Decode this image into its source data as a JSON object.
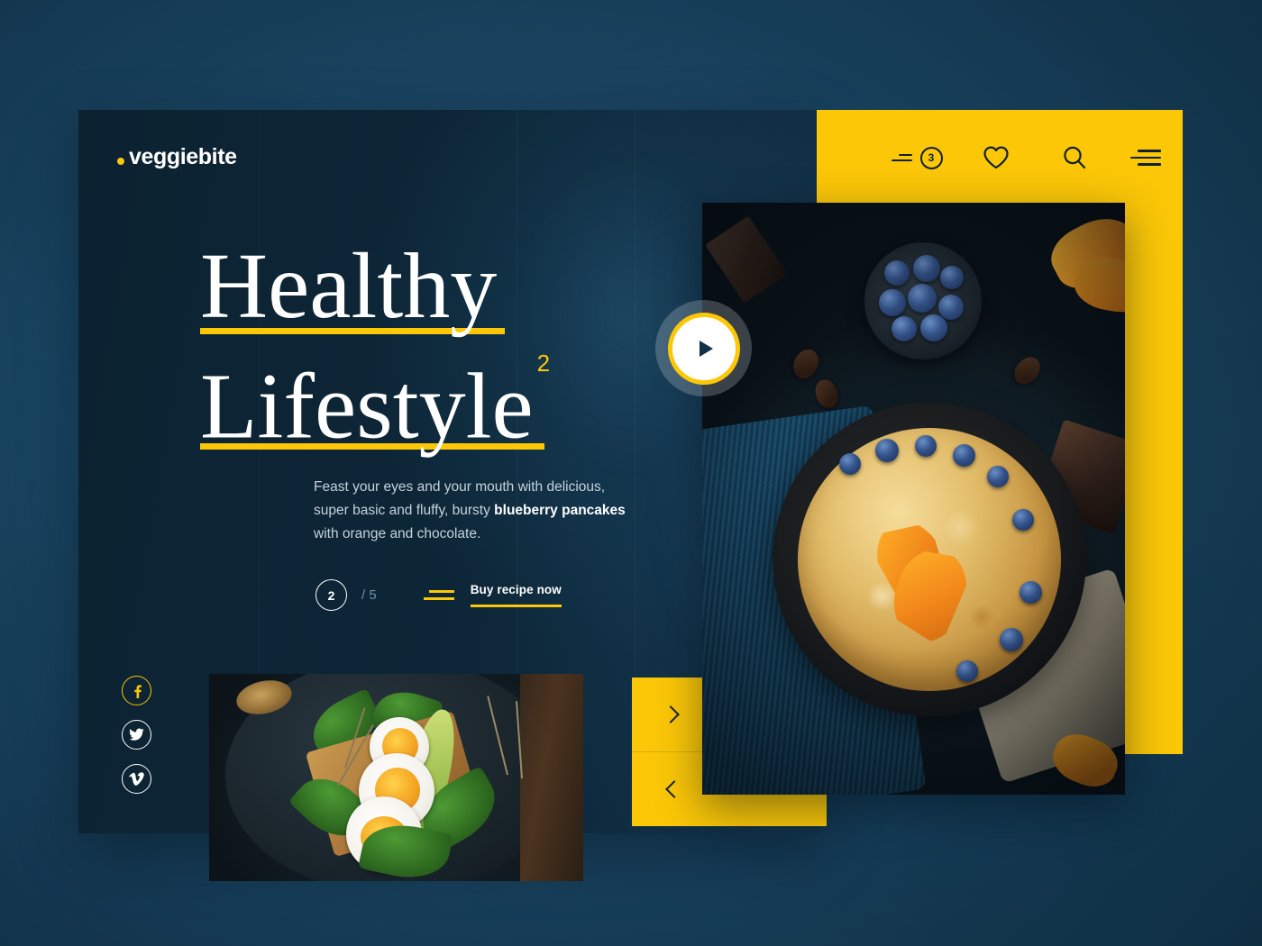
{
  "brand": {
    "dot": "•",
    "name": "veggiebite"
  },
  "colors": {
    "accent_yellow": "#fbc707",
    "card_navy": "#0d2434",
    "page_blue": "#1d4a69",
    "text_white": "#ffffff",
    "text_muted": "#c6d2da"
  },
  "header": {
    "cart": {
      "icon": "cart-lines-icon",
      "badge_count": "3"
    },
    "favorites": {
      "icon": "heart-icon",
      "label": "Favorites"
    },
    "search": {
      "icon": "search-icon",
      "label": "Search"
    },
    "menu": {
      "icon": "hamburger-menu-icon",
      "label": "Menu"
    }
  },
  "hero": {
    "headline_line1": "Healthy",
    "headline_line2": "Lifestyle",
    "headline_superscript": "2",
    "lede_part1": "Feast your eyes and your mouth with delicious, super basic and fluffy, bursty ",
    "lede_highlight": "blueberry pancakes",
    "lede_part2": " with orange and chocolate."
  },
  "pager": {
    "current": "2",
    "total": "/ 5"
  },
  "cta": {
    "icon": "lines-icon",
    "label": "Buy recipe now"
  },
  "social": [
    {
      "name": "facebook",
      "glyph": "f",
      "active": true
    },
    {
      "name": "twitter",
      "glyph": "t",
      "active": false
    },
    {
      "name": "vimeo",
      "glyph": "v",
      "active": false
    }
  ],
  "media": {
    "play_button": {
      "icon": "play-icon",
      "label": "Play video"
    },
    "main_photo_alt": "Blueberry pancakes in a cast iron skillet with orange slices and chocolate",
    "thumb_photo_alt": "Soft boiled egg and avocado toast on spinach"
  },
  "slider": {
    "next_icon": "chevron-right-icon",
    "prev_icon": "chevron-left-icon"
  }
}
